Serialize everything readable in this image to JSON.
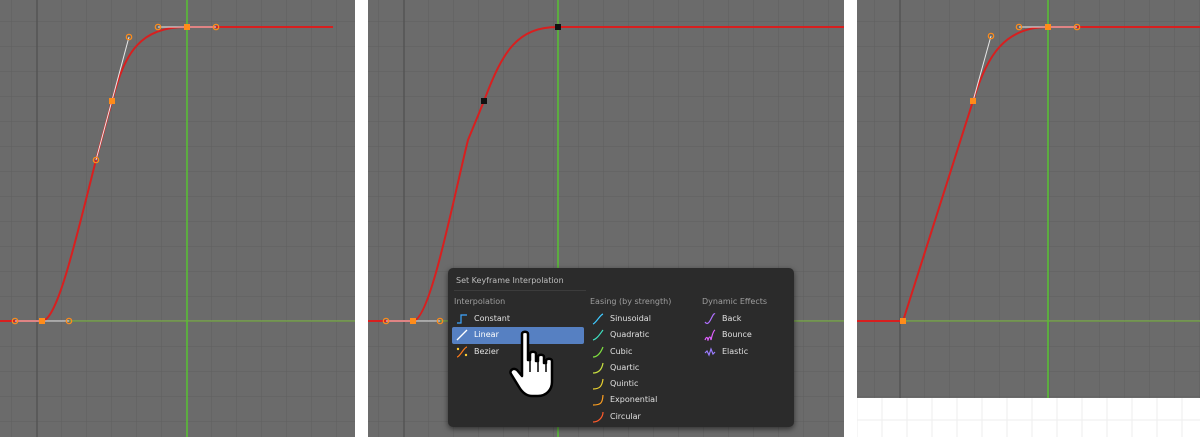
{
  "colors": {
    "background": "#6b6b6b",
    "grid_line": "#5f5f5f",
    "curve": "#d81f1f",
    "handle": "#ff8c1a",
    "x_axis": "#7fbf3f",
    "current_frame": "#58c232",
    "menu_background": "#2b2b2b",
    "menu_highlight": "#5680c2"
  },
  "panels": [
    {
      "name": "bezier-curve-view",
      "interpolation": "Bezier"
    },
    {
      "name": "menu-open-view",
      "interpolation": "Bezier"
    },
    {
      "name": "linear-curve-view",
      "interpolation": "Linear"
    }
  ],
  "menu": {
    "title": "Set Keyframe Interpolation",
    "sections": [
      {
        "header": "Interpolation",
        "items": [
          {
            "label": "Constant",
            "icon": "constant-icon",
            "highlighted": false
          },
          {
            "label": "Linear",
            "icon": "linear-icon",
            "highlighted": true
          },
          {
            "label": "Bezier",
            "icon": "bezier-icon",
            "highlighted": false
          }
        ]
      },
      {
        "header": "Easing (by strength)",
        "items": [
          {
            "label": "Sinusoidal",
            "icon": "sinusoidal-icon"
          },
          {
            "label": "Quadratic",
            "icon": "quadratic-icon"
          },
          {
            "label": "Cubic",
            "icon": "cubic-icon"
          },
          {
            "label": "Quartic",
            "icon": "quartic-icon"
          },
          {
            "label": "Quintic",
            "icon": "quintic-icon"
          },
          {
            "label": "Exponential",
            "icon": "exponential-icon"
          },
          {
            "label": "Circular",
            "icon": "circular-icon"
          }
        ]
      },
      {
        "header": "Dynamic Effects",
        "items": [
          {
            "label": "Back",
            "icon": "back-icon"
          },
          {
            "label": "Bounce",
            "icon": "bounce-icon"
          },
          {
            "label": "Elastic",
            "icon": "elastic-icon"
          }
        ]
      }
    ]
  },
  "cursor": {
    "type": "hand-pointer"
  }
}
